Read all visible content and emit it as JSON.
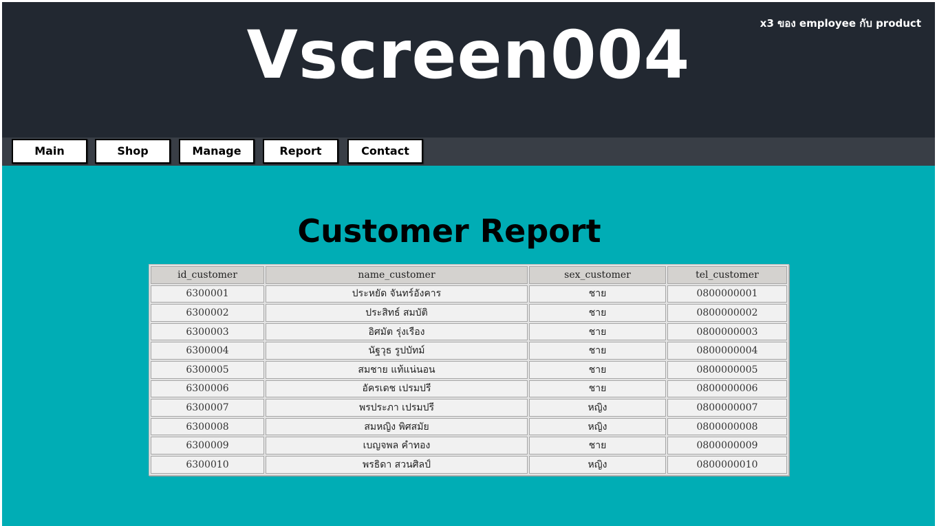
{
  "header": {
    "site_title": "Vscreen004",
    "note": "x3 ของ employee กับ product"
  },
  "nav": {
    "items": [
      {
        "label": "Main"
      },
      {
        "label": "Shop"
      },
      {
        "label": "Manage"
      },
      {
        "label": "Report"
      },
      {
        "label": "Contact"
      }
    ]
  },
  "main": {
    "heading": "Customer Report",
    "table": {
      "columns": [
        "id_customer",
        "name_customer",
        "sex_customer",
        "tel_customer"
      ],
      "rows": [
        [
          "6300001",
          "ประหยัด จันทร์อังคาร",
          "ชาย",
          "0800000001"
        ],
        [
          "6300002",
          "ประสิทธ์ สมบัติ",
          "ชาย",
          "0800000002"
        ],
        [
          "6300003",
          "อิศมัต รุ่งเรือง",
          "ชาย",
          "0800000003"
        ],
        [
          "6300004",
          "นัฐวุธ รูปบัทม์",
          "ชาย",
          "0800000004"
        ],
        [
          "6300005",
          "สมชาย แท้แน่นอน",
          "ชาย",
          "0800000005"
        ],
        [
          "6300006",
          "อัครเดช เปรมปรี",
          "ชาย",
          "0800000006"
        ],
        [
          "6300007",
          "พรประภา เปรมปรี",
          "หญิง",
          "0800000007"
        ],
        [
          "6300008",
          "สมหญิง พิศสมัย",
          "หญิง",
          "0800000008"
        ],
        [
          "6300009",
          "เบญจพล คำทอง",
          "ชาย",
          "0800000009"
        ],
        [
          "6300010",
          "พรธิดา สวนศิลป์",
          "หญิง",
          "0800000010"
        ]
      ]
    }
  },
  "colors": {
    "header_bg": "#222831",
    "nav_bg": "#393e46",
    "page_bg": "#00adb5"
  }
}
